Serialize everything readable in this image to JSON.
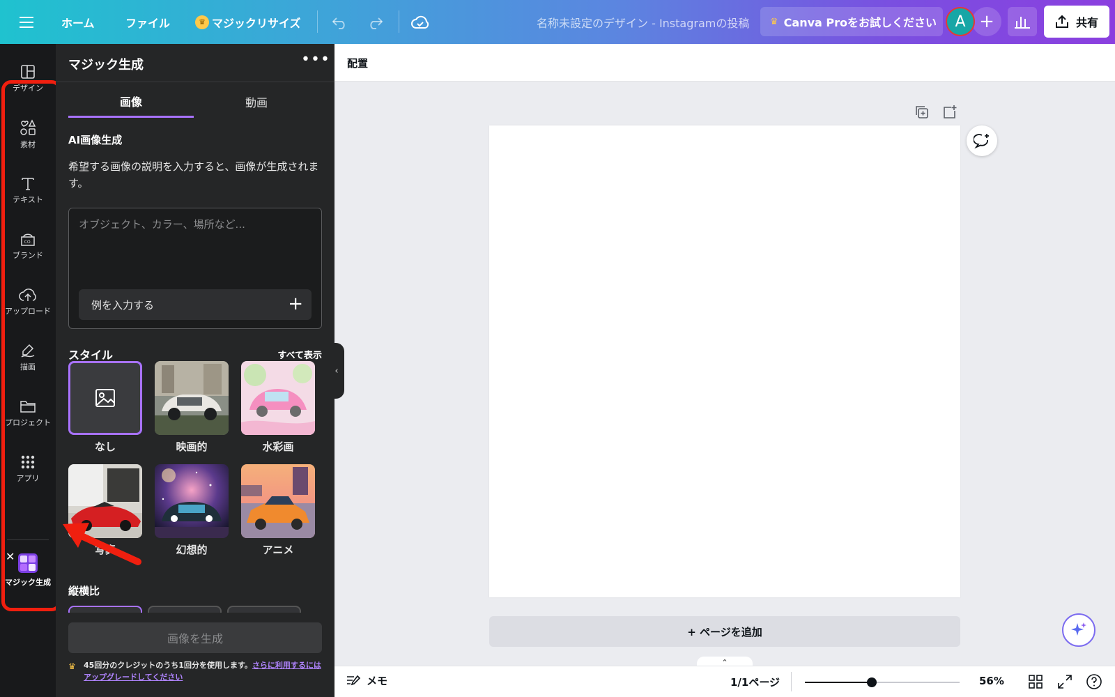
{
  "topbar": {
    "home": "ホーム",
    "file": "ファイル",
    "magic_resize": "マジックリサイズ",
    "doc_title": "名称未設定のデザイン - Instagramの投稿",
    "pro_cta": "Canva Proをお試しください",
    "avatar_initial": "A",
    "share": "共有"
  },
  "rail": {
    "items": [
      {
        "label": "デザイン",
        "icon": "layout-icon"
      },
      {
        "label": "素材",
        "icon": "elements-icon"
      },
      {
        "label": "テキスト",
        "icon": "text-icon"
      },
      {
        "label": "ブランド",
        "icon": "brand-icon"
      },
      {
        "label": "アップロード",
        "icon": "upload-cloud-icon"
      },
      {
        "label": "描画",
        "icon": "draw-icon"
      },
      {
        "label": "プロジェクト",
        "icon": "folder-icon"
      },
      {
        "label": "アプリ",
        "icon": "apps-grid-icon"
      }
    ],
    "active_app": "マジック生成",
    "highlight_color": "#f01f0f"
  },
  "panel": {
    "title": "マジック生成",
    "tabs": [
      "画像",
      "動画"
    ],
    "active_tab": "画像",
    "ai_title": "AI画像生成",
    "ai_desc": "希望する画像の説明を入力すると、画像が生成されます。",
    "prompt_placeholder": "オブジェクト、カラー、場所など...",
    "example_button": "例を入力する",
    "style_title": "スタイル",
    "style_show_all": "すべて表示",
    "styles": [
      {
        "label": "なし",
        "selected": true
      },
      {
        "label": "映画的"
      },
      {
        "label": "水彩画"
      },
      {
        "label": "写真"
      },
      {
        "label": "幻想的"
      },
      {
        "label": "アニメ"
      }
    ],
    "aspect_title": "縦横比",
    "generate_button": "画像を生成",
    "credit_text": "45回分のクレジットのうち1回分を使用します。",
    "credit_link": "さらに利用するにはアップグレードしてください",
    "accent_color": "#a872ff"
  },
  "workspace": {
    "toolbar_label": "配置",
    "add_page": "+ ページを追加"
  },
  "bottombar": {
    "memo": "メモ",
    "page_count": "1/1ページ",
    "zoom": "56%",
    "zoom_level": 0.56
  }
}
